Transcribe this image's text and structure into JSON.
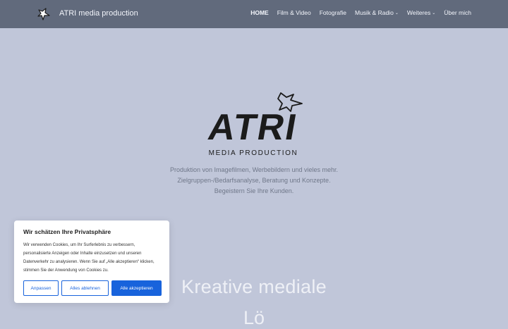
{
  "header": {
    "brand_name": "ATRI media production",
    "logo_icon": "star-burst-icon"
  },
  "nav": {
    "items": [
      {
        "label": "HOME",
        "active": true,
        "has_dropdown": false
      },
      {
        "label": "Film & Video",
        "active": false,
        "has_dropdown": false
      },
      {
        "label": "Fotografie",
        "active": false,
        "has_dropdown": false
      },
      {
        "label": "Musik & Radio",
        "active": false,
        "has_dropdown": true
      },
      {
        "label": "Weiteres",
        "active": false,
        "has_dropdown": true
      },
      {
        "label": "Über mich",
        "active": false,
        "has_dropdown": false
      }
    ],
    "dropdown_icon": "chevron-down-icon"
  },
  "hero": {
    "logo_text": "ATRI",
    "logo_subtext": "MEDIA PRODUCTION",
    "tagline_lines": [
      "Produktion von Imagefilmen, Werbebildern und vieles mehr.",
      "Zielgruppen-/Bedarfsanalyse, Beratung und Konzepte.",
      "Begeistern Sie Ihre Kunden."
    ],
    "heading": "Kreative mediale",
    "heading_partial": "Lö"
  },
  "cookie_banner": {
    "title": "Wir schätzen Ihre Privatsphäre",
    "text": "Wir verwenden Cookies, um Ihr Surferlebnis zu verbessern, personalisierte Anzeigen oder Inhalte einzusetzen und unseren Datenverkehr zu analysieren. Wenn Sie auf „Alle akzeptieren“ klicken, stimmen Sie der Anwendung von Cookies zu.",
    "buttons": {
      "customize": "Anpassen",
      "reject": "Alles ablehnen",
      "accept": "Alle akzeptieren"
    }
  },
  "colors": {
    "header_bg": "#616a7c",
    "page_bg": "#c0c6d9",
    "accent_blue": "#1863dc",
    "tagline": "#6f7789"
  }
}
